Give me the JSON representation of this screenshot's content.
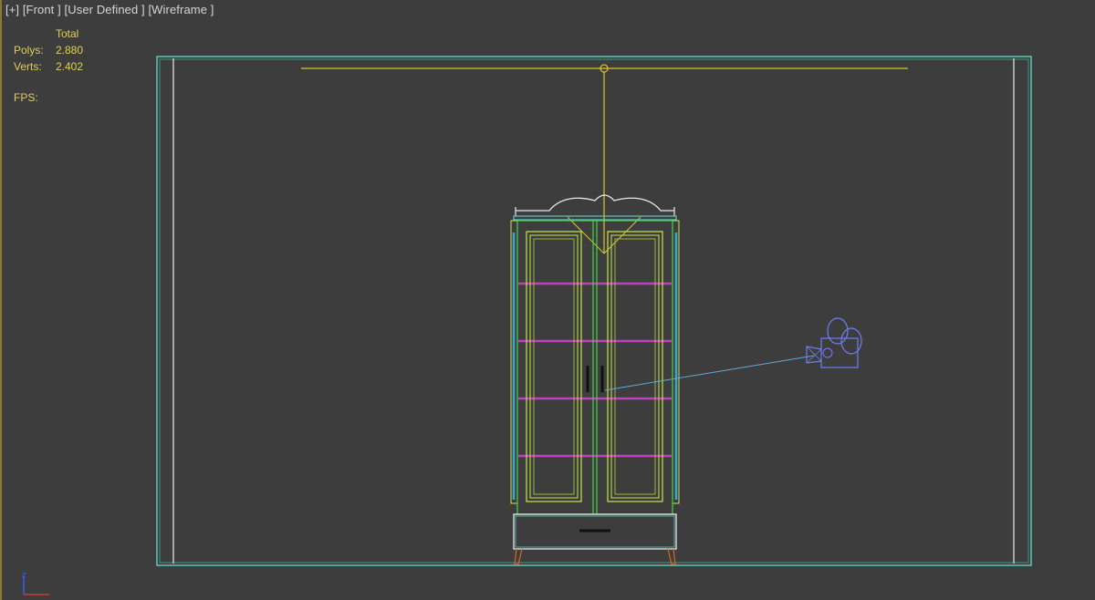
{
  "viewport": {
    "labels": [
      "[+]",
      "[Front ]",
      "[User Defined ]",
      "[Wireframe ]"
    ],
    "stats": {
      "header": "Total",
      "rows": [
        {
          "key": "Polys:",
          "value": "2.880"
        },
        {
          "key": "Verts:",
          "value": "2.402"
        }
      ],
      "fps_label": "FPS:"
    },
    "axis_label": "z"
  },
  "colors": {
    "background": "#3d3d3d",
    "wall_outline": "#5fc7b3",
    "wall_white": "#e8e8e8",
    "light_line": "#d7c72a",
    "cabinet_frame": "#c8e64a",
    "cabinet_green": "#4ad24a",
    "shelf": "#c040c0",
    "side_blue": "#3aa7c9",
    "camera": "#6f7ff0",
    "legs": "#d2691e",
    "stats_text": "#e0cf58"
  }
}
